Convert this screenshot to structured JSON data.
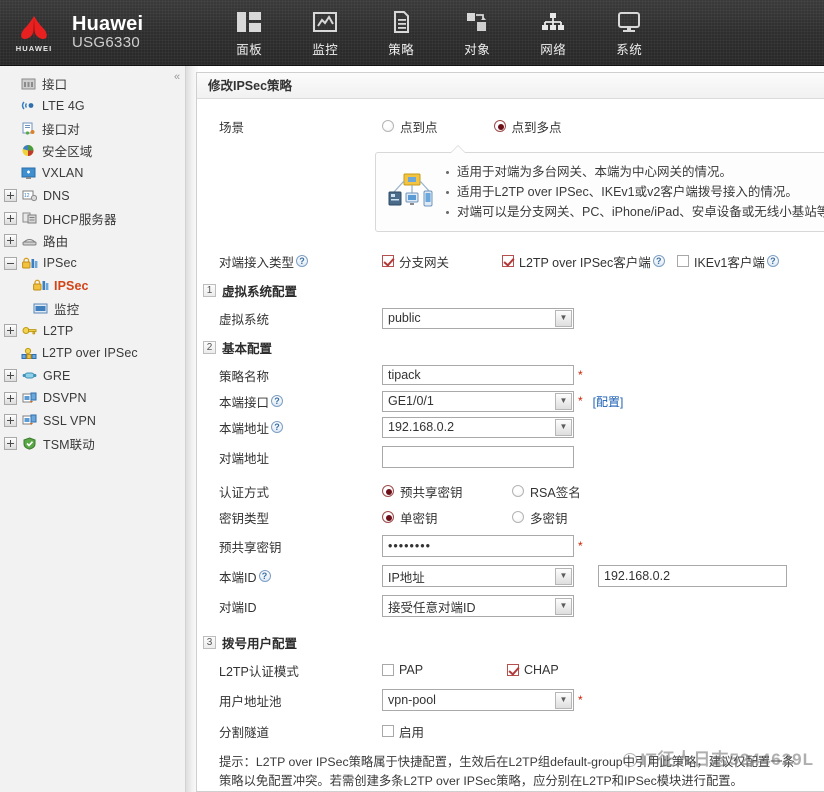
{
  "header": {
    "logo_icon": "huawei-logo-icon",
    "logo_word": "HUAWEI",
    "brand_name": "Huawei",
    "brand_model": "USG6330",
    "nav": [
      {
        "label": "面板",
        "icon": "dashboard-icon"
      },
      {
        "label": "监控",
        "icon": "monitor-chart-icon"
      },
      {
        "label": "策略",
        "icon": "policy-document-icon"
      },
      {
        "label": "对象",
        "icon": "object-icon"
      },
      {
        "label": "网络",
        "icon": "network-topology-icon"
      },
      {
        "label": "系统",
        "icon": "system-display-icon"
      }
    ]
  },
  "sidebar": {
    "collapse_icon": "chevron-double-left-icon",
    "items": [
      {
        "label": "接口",
        "icon": "interface-icon",
        "expander": "none",
        "indent": 1,
        "selected": false
      },
      {
        "label": "LTE 4G",
        "icon": "lte-signal-icon",
        "expander": "none",
        "indent": 1,
        "selected": false
      },
      {
        "label": "接口对",
        "icon": "interface-pair-icon",
        "expander": "none",
        "indent": 1,
        "selected": false
      },
      {
        "label": "安全区域",
        "icon": "security-zone-icon",
        "expander": "none",
        "indent": 1,
        "selected": false
      },
      {
        "label": "VXLAN",
        "icon": "vxlan-icon",
        "expander": "none",
        "indent": 1,
        "selected": false
      },
      {
        "label": "DNS",
        "icon": "dns-icon",
        "expander": "plus",
        "indent": 0,
        "selected": false
      },
      {
        "label": "DHCP服务器",
        "icon": "dhcp-server-icon",
        "expander": "plus",
        "indent": 0,
        "selected": false
      },
      {
        "label": "路由",
        "icon": "route-icon",
        "expander": "plus",
        "indent": 0,
        "selected": false
      },
      {
        "label": "IPSec",
        "icon": "ipsec-lock-icon",
        "expander": "minus",
        "indent": 0,
        "selected": false
      },
      {
        "label": "IPSec",
        "icon": "ipsec-lock-icon",
        "expander": "none",
        "indent": 2,
        "selected": true
      },
      {
        "label": "监控",
        "icon": "monitor-small-icon",
        "expander": "none",
        "indent": 2,
        "selected": false
      },
      {
        "label": "L2TP",
        "icon": "l2tp-key-icon",
        "expander": "plus",
        "indent": 0,
        "selected": false
      },
      {
        "label": "L2TP over IPSec",
        "icon": "l2tp-ipsec-icon",
        "expander": "none",
        "indent": 1,
        "selected": false
      },
      {
        "label": "GRE",
        "icon": "gre-tunnel-icon",
        "expander": "plus",
        "indent": 0,
        "selected": false
      },
      {
        "label": "DSVPN",
        "icon": "dsvpn-icon",
        "expander": "plus",
        "indent": 0,
        "selected": false
      },
      {
        "label": "SSL VPN",
        "icon": "sslvpn-icon",
        "expander": "plus",
        "indent": 0,
        "selected": false
      },
      {
        "label": "TSM联动",
        "icon": "tsm-shield-icon",
        "expander": "plus",
        "indent": 0,
        "selected": false
      }
    ]
  },
  "panel": {
    "title": "修改IPSec策略",
    "scene": {
      "label": "场景",
      "options": [
        {
          "label": "点到点",
          "checked": false
        },
        {
          "label": "点到多点",
          "checked": true
        }
      ]
    },
    "callout": {
      "image_icon": "network-topology-illustration",
      "bullets": [
        "适用于对端为多台网关、本端为中心网关的情况。",
        "适用于L2TP over IPSec、IKEv1或v2客户端拨号接入的情况。",
        "对端可以是分支网关、PC、iPhone/iPad、安卓设备或无线小基站等"
      ]
    },
    "peer_access": {
      "label": "对端接入类型",
      "has_help": true,
      "options": [
        {
          "label": "分支网关",
          "checked": true,
          "has_help": false
        },
        {
          "label": "L2TP over IPSec客户端",
          "checked": true,
          "has_help": true
        },
        {
          "label": "IKEv1客户端",
          "checked": false,
          "has_help": true
        }
      ]
    },
    "sections": [
      {
        "num": "1",
        "title": "虚拟系统配置"
      },
      {
        "num": "2",
        "title": "基本配置"
      },
      {
        "num": "3",
        "title": "拨号用户配置"
      }
    ],
    "vsys": {
      "label": "虚拟系统",
      "value": "public"
    },
    "basic": {
      "policy_name": {
        "label": "策略名称",
        "value": "tipack",
        "required": true,
        "has_help": false
      },
      "local_if": {
        "label": "本端接口",
        "value": "GE1/0/1",
        "required": true,
        "has_help": true,
        "link": "[配置]"
      },
      "local_addr": {
        "label": "本端地址",
        "value": "192.168.0.2",
        "required": false,
        "has_help": true
      },
      "peer_addr": {
        "label": "对端地址",
        "value": "",
        "placeholder": "",
        "required": false,
        "has_help": false
      },
      "auth_method": {
        "label": "认证方式",
        "options": [
          {
            "label": "预共享密钥",
            "checked": true
          },
          {
            "label": "RSA签名",
            "checked": false
          }
        ]
      },
      "key_type": {
        "label": "密钥类型",
        "options": [
          {
            "label": "单密钥",
            "checked": true
          },
          {
            "label": "多密钥",
            "checked": false
          }
        ]
      },
      "psk": {
        "label": "预共享密钥",
        "value": "••••••••",
        "required": true
      },
      "local_id": {
        "label": "本端ID",
        "has_help": true,
        "select_value": "IP地址",
        "text_value": "192.168.0.2"
      },
      "peer_id": {
        "label": "对端ID",
        "has_help": false,
        "select_value": "接受任意对端ID"
      }
    },
    "dialup": {
      "l2tp_auth": {
        "label": "L2TP认证模式",
        "options": [
          {
            "label": "PAP",
            "checked": false
          },
          {
            "label": "CHAP",
            "checked": true
          }
        ]
      },
      "user_pool": {
        "label": "用户地址池",
        "value": "vpn-pool",
        "required": true
      },
      "split_tunnel": {
        "label": "分割隧道",
        "option_label": "启用",
        "checked": false
      }
    },
    "tip_text": "提示：L2TP over IPSec策略属于快捷配置，生效后在L2TP组default-group中引用此策略，建议仅配置一条策略以免配置冲突。若需创建多条L2TP over IPSec策略，应分别在L2TP和IPSec模块进行配置。"
  },
  "watermark": {
    "text": "IT征人日志5244629L"
  },
  "colors": {
    "header_bg": "#2e2e2e",
    "accent_red": "#d24318",
    "selected_radio": "#6d0f19",
    "checkbox_check": "#b33a3a",
    "link_blue": "#1a5fb4",
    "required_star": "#cc2200",
    "sidebar_bg": "#f2f2f2"
  }
}
